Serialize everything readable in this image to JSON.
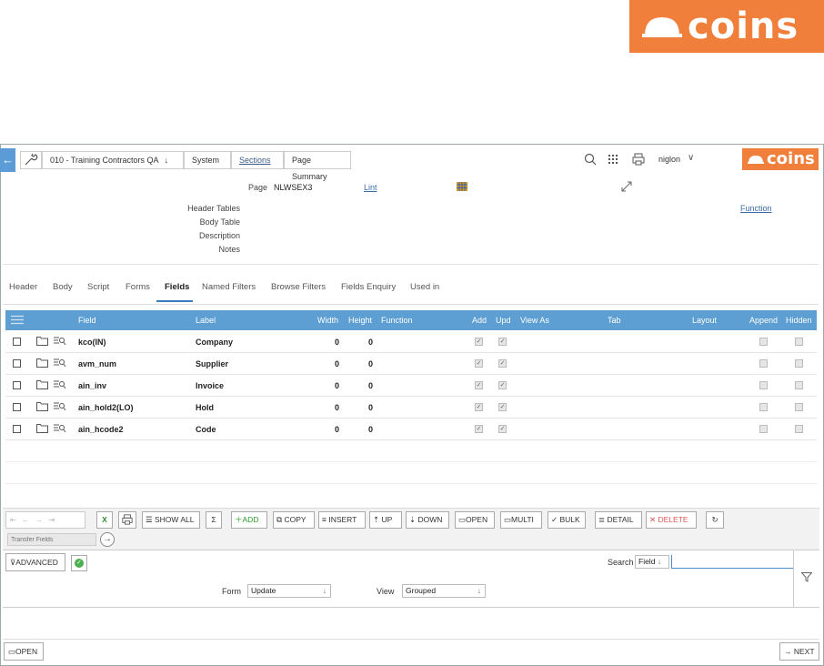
{
  "brand": {
    "logo_text": "coins",
    "color": "#f07f3c"
  },
  "breadcrumb": {
    "company": "010 - Training Contractors QA",
    "items": [
      "System",
      "Sections",
      "Page Summary"
    ]
  },
  "topbar": {
    "user": "niglon"
  },
  "page_info": {
    "page_label": "Page",
    "page_value": "NLWSEX3",
    "lint_link": "Lint",
    "function_link": "Function",
    "fields": [
      "Header Tables",
      "Body Table",
      "Description",
      "Notes"
    ]
  },
  "tabs": [
    "Header",
    "Body",
    "Script",
    "Forms",
    "Fields",
    "Named Filters",
    "Browse Filters",
    "Fields Enquiry",
    "Used in"
  ],
  "active_tab": "Fields",
  "grid": {
    "columns": [
      "Field",
      "Label",
      "Width",
      "Height",
      "Function",
      "Add",
      "Upd",
      "View As",
      "Tab",
      "Layout",
      "Append",
      "Hidden"
    ],
    "rows": [
      {
        "field": "kco(IN)",
        "label": "Company",
        "width": "0",
        "height": "0",
        "add": true,
        "upd": true
      },
      {
        "field": "avm_num",
        "label": "Supplier",
        "width": "0",
        "height": "0",
        "add": true,
        "upd": true
      },
      {
        "field": "ain_inv",
        "label": "Invoice",
        "width": "0",
        "height": "0",
        "add": true,
        "upd": true
      },
      {
        "field": "ain_hold2(LO)",
        "label": "Hold",
        "width": "0",
        "height": "0",
        "add": true,
        "upd": true
      },
      {
        "field": "ain_hcode2",
        "label": "Code",
        "width": "0",
        "height": "0",
        "add": true,
        "upd": true
      }
    ]
  },
  "toolbar": {
    "show_all": "SHOW ALL",
    "sum": "Σ",
    "add": "ADD",
    "copy": "COPY",
    "insert": "INSERT",
    "up": "UP",
    "down": "DOWN",
    "open": "OPEN",
    "multi": "MULTI",
    "bulk": "BULK",
    "detail": "DETAIL",
    "delete": "DELETE",
    "transfer_placeholder": "Transfer Fields"
  },
  "filter": {
    "advanced": "ADVANCED",
    "search_label": "Search",
    "search_field": "Field",
    "search_value": "",
    "form_label": "Form",
    "form_value": "Update",
    "view_label": "View",
    "view_value": "Grouped"
  },
  "footer": {
    "open": "OPEN",
    "next": "NEXT"
  }
}
